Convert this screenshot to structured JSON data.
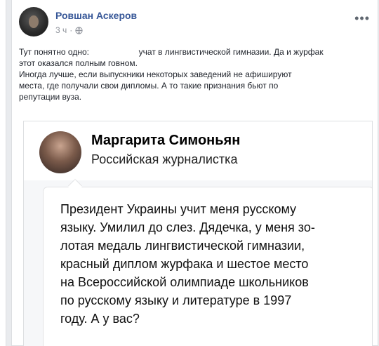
{
  "post": {
    "author": "Ровшан Аскеров",
    "time": "3 ч",
    "privacy_icon": "globe-icon",
    "more_icon": "more-icon",
    "text_line1_a": "Тут понятно одно:",
    "text_line1_b": "учат в лингвистической гимназии. Да и журфак",
    "text_line2": "этот оказался полным говном.",
    "text_line3": "Иногда лучше, если выпускники некоторых заведений не афишируют",
    "text_line4": "места, где получали свои дипломы. А то такие признания бьют по",
    "text_line5": "репутации вуза."
  },
  "embed": {
    "name": "Маргарита Симоньян",
    "role": "Российская журналистка",
    "quote_lines": [
      "Президент Украины учит меня русскому",
      "языку. Умилил до слез. Дядечка, у меня зо-",
      "лотая медаль лингвистической гимназии,",
      "красный диплом журфака и шестое место",
      "на Всероссийской олимпиаде школьников",
      "по русскому языку и литературе в 1997",
      "году. А у вас?"
    ]
  }
}
